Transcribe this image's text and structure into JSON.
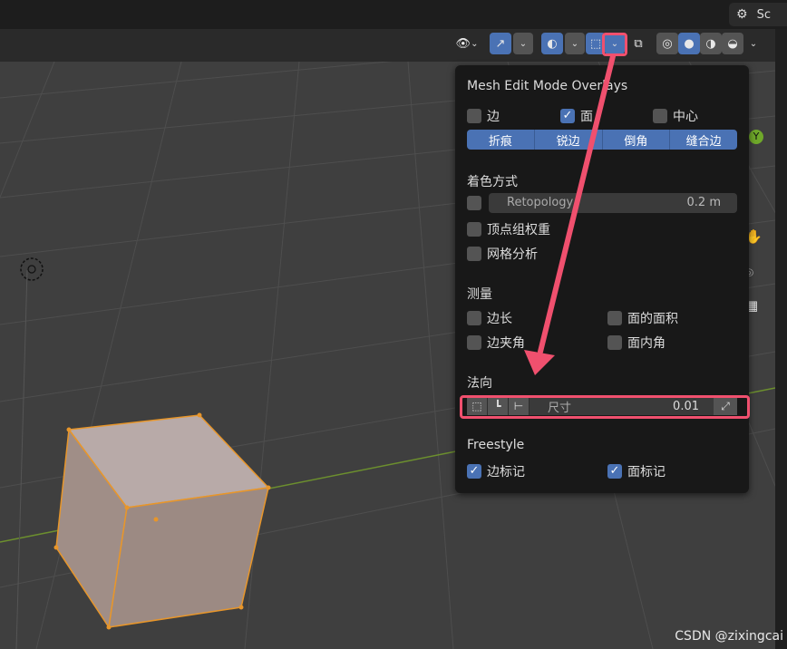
{
  "topbar": {
    "scene_label": "Sc",
    "scene_icon": "scene-icon"
  },
  "header": {
    "buttons": [
      {
        "icon": "eye-icon"
      },
      {
        "icon": "gizmo-icon"
      },
      {
        "icon": "overlay-icon"
      },
      {
        "icon": "mesh-edit-overlay-icon"
      },
      {
        "icon": "xray-icon"
      },
      {
        "icon": "wireframe-shading-icon"
      },
      {
        "icon": "solid-shading-icon"
      },
      {
        "icon": "material-shading-icon"
      },
      {
        "icon": "rendered-shading-icon"
      }
    ]
  },
  "panel": {
    "title": "Mesh Edit Mode Overlays",
    "row1": [
      {
        "label": "边",
        "checked": false
      },
      {
        "label": "面",
        "checked": true
      },
      {
        "label": "中心",
        "checked": false
      }
    ],
    "segment": [
      "折痕",
      "锐边",
      "倒角",
      "缝合边"
    ],
    "shading_label": "着色方式",
    "retopology": {
      "label": "Retopology",
      "value": "0.2 m",
      "checked": false
    },
    "vertex_group": {
      "label": "顶点组权重",
      "checked": false
    },
    "mesh_analysis": {
      "label": "网格分析",
      "checked": false
    },
    "measure_label": "测量",
    "measure": [
      {
        "label": "边长",
        "checked": false
      },
      {
        "label": "面的面积",
        "checked": false
      },
      {
        "label": "边夹角",
        "checked": false
      },
      {
        "label": "面内角",
        "checked": false
      }
    ],
    "normals_label": "法向",
    "normals": {
      "size_label": "尺寸",
      "size_value": "0.01"
    },
    "freestyle_label": "Freestyle",
    "freestyle": [
      {
        "label": "边标记",
        "checked": true
      },
      {
        "label": "面标记",
        "checked": true
      }
    ]
  },
  "side_icons": [
    "y-axis-icon",
    "pan-hand-icon",
    "camera-icon",
    "grid-icon"
  ],
  "watermark": "CSDN @zixingcai",
  "colors": {
    "accent": "#4a72b4",
    "highlight_red": "#f0506e",
    "mesh_edge": "#e8962a"
  }
}
